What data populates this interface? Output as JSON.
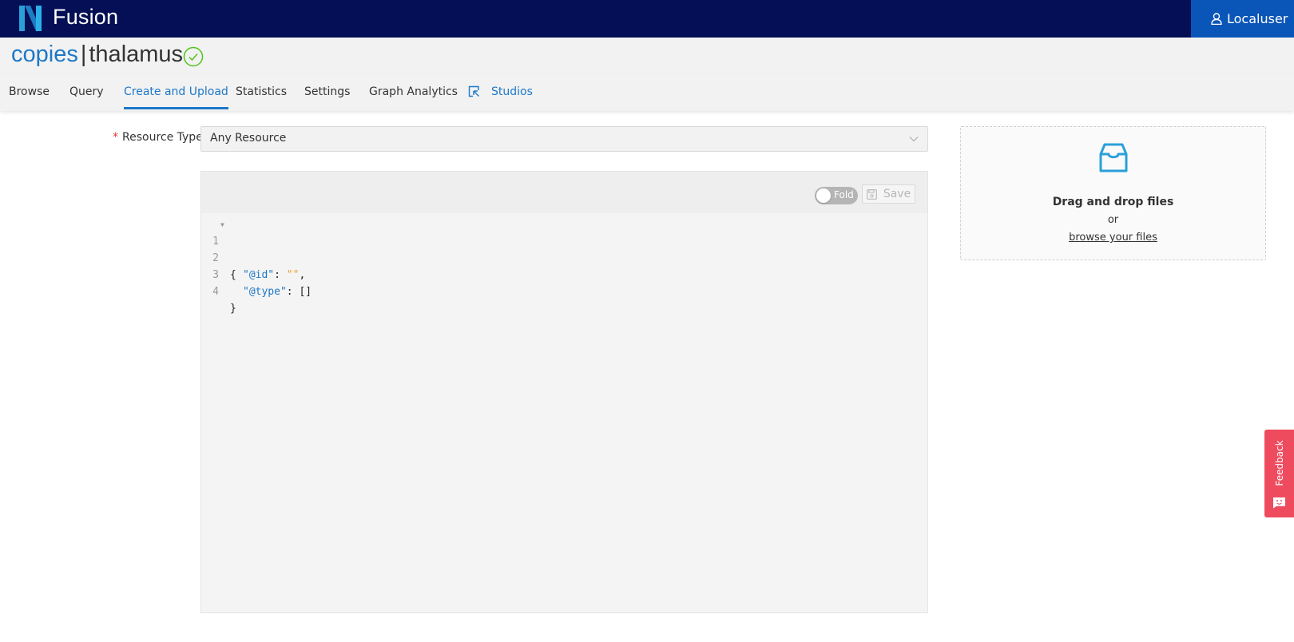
{
  "header": {
    "app_name": "Fusion",
    "user_label": "Localuser",
    "logo_icon": "nexus-logo-icon",
    "user_icon": "user-icon"
  },
  "project": {
    "org": "copies",
    "separator": "|",
    "name": "thalamus",
    "status_icon": "check-circle-icon",
    "status_color": "#52c41a"
  },
  "tabs": [
    {
      "label": "Browse",
      "active": false
    },
    {
      "label": "Query",
      "active": false
    },
    {
      "label": "Create and Upload",
      "active": true
    },
    {
      "label": "Statistics",
      "active": false
    },
    {
      "label": "Settings",
      "active": false
    },
    {
      "label": "Graph Analytics",
      "active": false
    },
    {
      "label": "Studios",
      "active": false,
      "icon": "external-select-icon"
    }
  ],
  "form": {
    "resource_type_label": "Resource Type :",
    "required_mark": "*",
    "resource_type_value": "Any Resource"
  },
  "editor": {
    "fold_label": "Fold",
    "fold_on": false,
    "save_label": "Save",
    "save_enabled": false,
    "lines": [
      {
        "n": "1",
        "text": "{"
      },
      {
        "n": "2",
        "key": "\"@id\"",
        "sep": ": ",
        "value": "\"\"",
        "tail": ","
      },
      {
        "n": "3",
        "key": "\"@type\"",
        "sep": ": ",
        "value": "[]",
        "tail": ""
      },
      {
        "n": "4",
        "text": "}"
      }
    ]
  },
  "dropzone": {
    "title": "Drag and drop files",
    "or": "or",
    "browse": "browse your files",
    "icon": "inbox-icon"
  },
  "feedback": {
    "label": "Feedback"
  },
  "colors": {
    "header_bg": "#050f55",
    "user_bg": "#0a55b8",
    "accent": "#1d78c8",
    "feedback": "#ef4b5e",
    "icon_blue": "#2aa0da"
  }
}
